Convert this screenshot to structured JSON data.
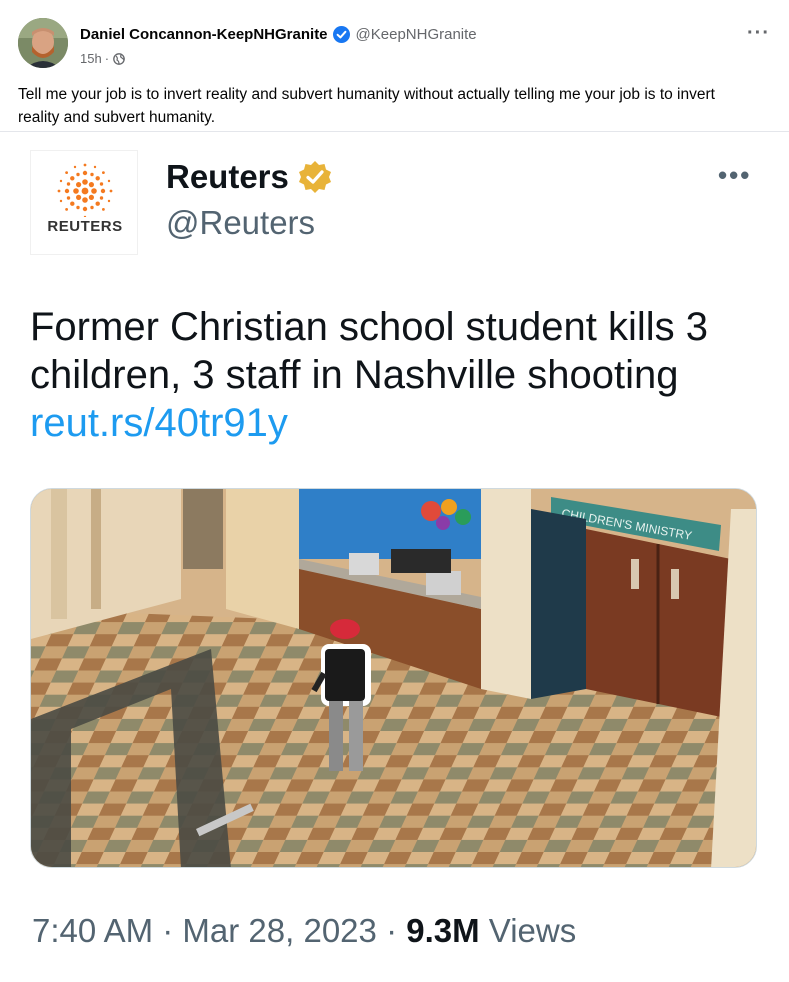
{
  "post": {
    "author_name": "Daniel Concannon-KeepNHGranite",
    "author_handle": "@KeepNHGranite",
    "time": "15h",
    "separator": "·",
    "more": "···",
    "text": "Tell me your job is to invert reality and subvert humanity without actually telling me your job is to invert reality and subvert humanity."
  },
  "tweet": {
    "logo_text": "REUTERS",
    "name": "Reuters",
    "handle": "@Reuters",
    "more": "•••",
    "headline": "Former Christian school student kills 3 children, 3 staff in Nashville shooting",
    "link": "reut.rs/40tr91y",
    "photo_sign": "CHILDREN'S MINISTRY",
    "time": "7:40 AM",
    "dot1": "·",
    "date": "Mar 28, 2023",
    "dot2": "·",
    "views_count": "9.3M",
    "views_label": "Views"
  },
  "colors": {
    "link_blue": "#1d9bf0",
    "verified_blue": "#1877f2",
    "gold_badge": "#e8b339",
    "reuters_orange": "#f47a20",
    "gray_text": "#536471"
  },
  "icons": {
    "verified": "verified-badge-icon",
    "globe": "globe-icon",
    "gold": "gold-verified-icon"
  }
}
